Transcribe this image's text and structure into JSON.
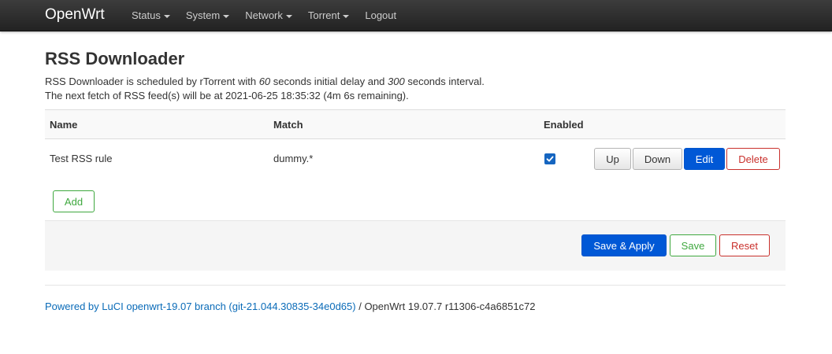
{
  "navbar": {
    "brand": "OpenWrt",
    "menu": [
      {
        "label": "Status",
        "dropdown": true
      },
      {
        "label": "System",
        "dropdown": true
      },
      {
        "label": "Network",
        "dropdown": true
      },
      {
        "label": "Torrent",
        "dropdown": true
      },
      {
        "label": "Logout",
        "dropdown": false
      }
    ]
  },
  "page": {
    "title": "RSS Downloader",
    "desc_line1": {
      "part1": "RSS Downloader is scheduled by rTorrent with ",
      "initial_delay": "60",
      "part2": " seconds initial delay and ",
      "interval": "300",
      "part3": " seconds interval."
    },
    "desc_line2": "The next fetch of RSS feed(s) will be at 2021-06-25 18:35:32 (4m 6s remaining)."
  },
  "table": {
    "headers": {
      "name": "Name",
      "match": "Match",
      "enabled": "Enabled"
    },
    "rows": [
      {
        "name": "Test RSS rule",
        "match": "dummy.*",
        "enabled": true
      }
    ],
    "row_buttons": {
      "up": "Up",
      "down": "Down",
      "edit": "Edit",
      "delete": "Delete"
    },
    "add_label": "Add"
  },
  "actions": {
    "save_apply": "Save & Apply",
    "save": "Save",
    "reset": "Reset"
  },
  "footer": {
    "link_text": "Powered by LuCI openwrt-19.07 branch (git-21.044.30835-34e0d65)",
    "version_text": " / OpenWrt 19.07.7 r11306-c4a6851c72"
  },
  "colors": {
    "primary": "#0058d6",
    "danger": "#c9302c",
    "success": "#3fa83f",
    "link": "#0a6bb8",
    "navbar": "#2a2a2a"
  },
  "icons": {
    "dropdown": "caret-down-icon",
    "checked": "checkmark-icon"
  }
}
